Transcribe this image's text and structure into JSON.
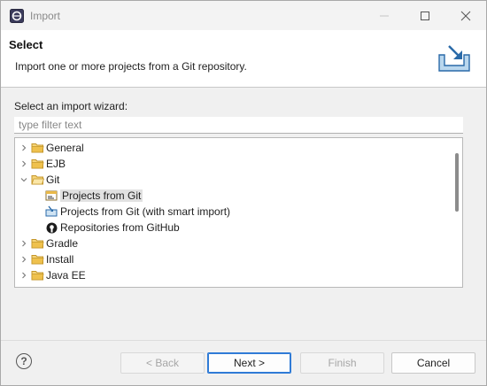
{
  "window": {
    "title": "Import"
  },
  "header": {
    "title": "Select",
    "description": "Import one or more projects from a Git repository."
  },
  "wizard": {
    "label": "Select an import wizard:",
    "filter_placeholder": "type filter text",
    "filter_value": ""
  },
  "tree": {
    "items": [
      {
        "label": "General",
        "icon": "folder-icon",
        "expanded": false,
        "level": 0
      },
      {
        "label": "EJB",
        "icon": "folder-icon",
        "expanded": false,
        "level": 0
      },
      {
        "label": "Git",
        "icon": "folder-open-icon",
        "expanded": true,
        "level": 0
      },
      {
        "label": "Projects from Git",
        "icon": "git-import-icon",
        "level": 1,
        "selected": true
      },
      {
        "label": "Projects from Git (with smart import)",
        "icon": "smart-import-icon",
        "level": 1
      },
      {
        "label": "Repositories from GitHub",
        "icon": "github-icon",
        "level": 1
      },
      {
        "label": "Gradle",
        "icon": "folder-icon",
        "expanded": false,
        "level": 0
      },
      {
        "label": "Install",
        "icon": "folder-icon",
        "expanded": false,
        "level": 0
      },
      {
        "label": "Java EE",
        "icon": "folder-icon",
        "expanded": false,
        "level": 0
      }
    ]
  },
  "buttons": {
    "help": "?",
    "back": "< Back",
    "next": "Next >",
    "finish": "Finish",
    "cancel": "Cancel"
  },
  "colors": {
    "accent": "#2f7bd6",
    "folder": "#e3b341",
    "selection": "#e1e1e1"
  }
}
